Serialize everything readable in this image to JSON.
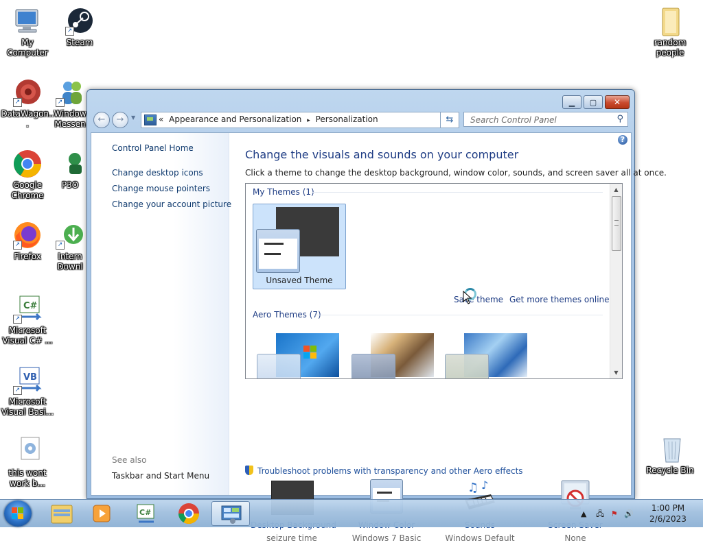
{
  "desktop": {
    "icons": [
      {
        "label": "My Computer"
      },
      {
        "label": "Steam"
      },
      {
        "label": "random people"
      },
      {
        "label": "DataWagon..."
      },
      {
        "label": "Window Messen"
      },
      {
        "label": "Google Chrome"
      },
      {
        "label": "P3O"
      },
      {
        "label": "Firefox"
      },
      {
        "label": "Intern Downl"
      },
      {
        "label": "Microsoft Visual C# ..."
      },
      {
        "label": "Microsoft Visual Basi..."
      },
      {
        "label": "this wont work b..."
      },
      {
        "label": "Recycle Bin"
      }
    ]
  },
  "window": {
    "address": {
      "prefix": "«",
      "crumbs": [
        "Appearance and Personalization",
        "Personalization"
      ],
      "separator": "▸"
    },
    "search_placeholder": "Search Control Panel",
    "left_pane": {
      "home": "Control Panel Home",
      "links": [
        "Change desktop icons",
        "Change mouse pointers",
        "Change your account picture"
      ],
      "see_also_label": "See also",
      "see_also_links": [
        "Taskbar and Start Menu"
      ]
    },
    "heading": "Change the visuals and sounds on your computer",
    "subtext": "Click a theme to change the desktop background, window color, sounds, and screen saver all at once.",
    "themes": {
      "my_themes_label": "My Themes (1)",
      "selected_theme": "Unsaved Theme",
      "save_theme": "Save theme",
      "get_more": "Get more themes online",
      "aero_label": "Aero Themes (7)"
    },
    "settings": [
      {
        "title": "Desktop Background",
        "value": "seizure time"
      },
      {
        "title": "Window Color",
        "value": "Windows 7 Basic"
      },
      {
        "title": "Sounds",
        "value": "Windows Default"
      },
      {
        "title": "Screen Saver",
        "value": "None"
      }
    ],
    "troubleshoot": "Troubleshoot problems with transparency and other Aero effects"
  },
  "taskbar": {
    "clock_time": "1:00 PM",
    "clock_date": "2/6/2023"
  },
  "colors": {
    "link": "#1e4f9b",
    "heading": "#1e3c84",
    "selection": "#cce3fb"
  }
}
